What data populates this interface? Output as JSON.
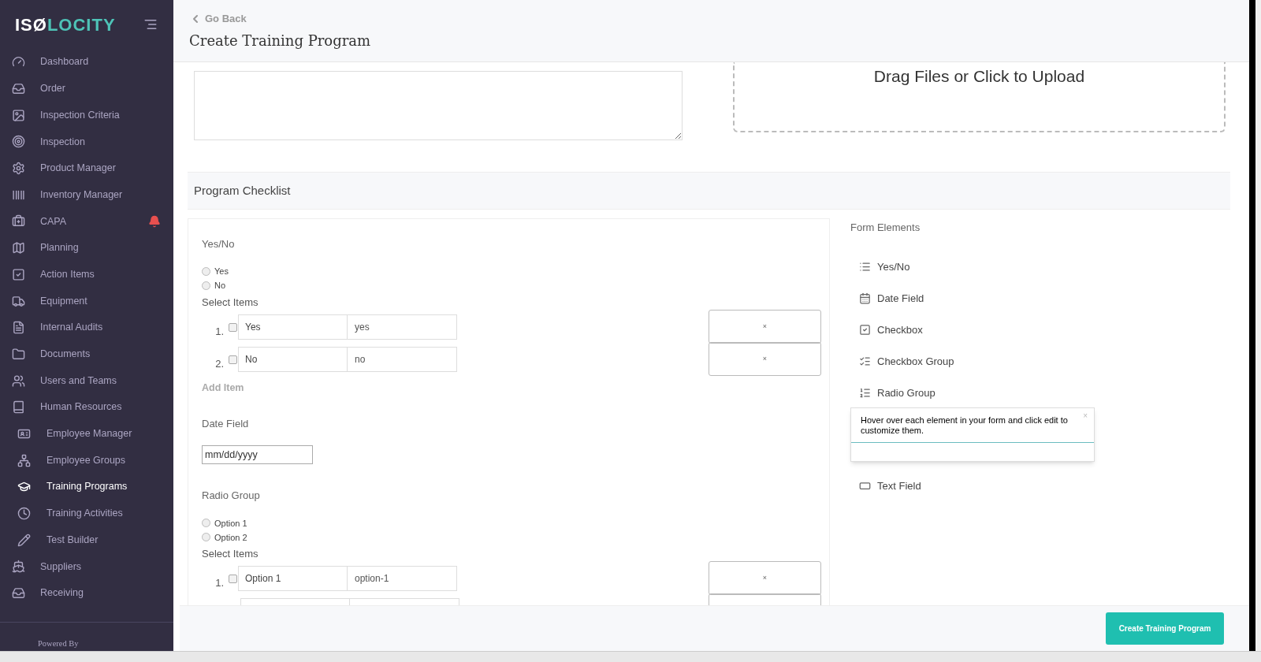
{
  "logo": {
    "lead": "ISØ",
    "rest": "LOCITY"
  },
  "sidebar": {
    "items": [
      {
        "label": "Dashboard",
        "selected": false,
        "alert": false
      },
      {
        "label": "Order",
        "selected": false,
        "alert": false
      },
      {
        "label": "Inspection Criteria",
        "selected": false,
        "alert": false
      },
      {
        "label": "Inspection",
        "selected": false,
        "alert": false
      },
      {
        "label": "Product Manager",
        "selected": false,
        "alert": false
      },
      {
        "label": "Inventory Manager",
        "selected": false,
        "alert": false
      },
      {
        "label": "CAPA",
        "selected": false,
        "alert": true
      },
      {
        "label": "Planning",
        "selected": false,
        "alert": false
      },
      {
        "label": "Action Items",
        "selected": false,
        "alert": false
      },
      {
        "label": "Equipment",
        "selected": false,
        "alert": false
      },
      {
        "label": "Internal Audits",
        "selected": false,
        "alert": false
      },
      {
        "label": "Documents",
        "selected": false,
        "alert": false
      },
      {
        "label": "Users and Teams",
        "selected": false,
        "alert": false
      },
      {
        "label": "Human Resources",
        "selected": false,
        "alert": false,
        "children": [
          {
            "label": "Employee Manager",
            "selected": false
          },
          {
            "label": "Employee Groups",
            "selected": false
          },
          {
            "label": "Training Programs",
            "selected": true
          },
          {
            "label": "Training Activities",
            "selected": false
          },
          {
            "label": "Test Builder",
            "selected": false
          }
        ]
      },
      {
        "label": "Suppliers",
        "selected": false,
        "alert": false
      },
      {
        "label": "Receiving",
        "selected": false,
        "alert": false
      }
    ],
    "footer": "Powered By"
  },
  "header": {
    "back": "Go Back",
    "title": "Create Training Program"
  },
  "upload": {
    "text": "Drag Files or Click to Upload"
  },
  "checklist": {
    "title": "Program Checklist",
    "sections": [
      {
        "kind": "choice",
        "title": "Yes/No",
        "options": [
          {
            "label": "Yes",
            "selected": false
          },
          {
            "label": "No",
            "selected": false
          }
        ],
        "select_label": "Select Items",
        "remove": "×",
        "items": [
          {
            "number": "1.",
            "checked": false,
            "label": "Yes",
            "value": "yes"
          },
          {
            "number": "2.",
            "checked": false,
            "label": "No",
            "value": "no"
          }
        ],
        "add_item": "Add Item"
      },
      {
        "kind": "date",
        "title": "Date Field",
        "placeholder": "mm/dd/yyyy"
      },
      {
        "kind": "choice",
        "title": "Radio Group",
        "options": [
          {
            "label": "Option 1",
            "selected": false
          },
          {
            "label": "Option 2",
            "selected": false
          }
        ],
        "select_label": "Select Items",
        "remove": "×",
        "items": [
          {
            "kind": "filled",
            "number": "1.",
            "checked": false,
            "label": "Option 1",
            "value": "option-1"
          },
          {
            "kind": "blank"
          }
        ]
      }
    ]
  },
  "form_elements": {
    "title": "Form Elements",
    "items": [
      {
        "label": "Yes/No"
      },
      {
        "label": "Date Field"
      },
      {
        "label": "Checkbox"
      },
      {
        "label": "Checkbox Group"
      },
      {
        "label": "Radio Group"
      },
      {
        "label": "Text Field"
      }
    ]
  },
  "tooltip": {
    "text": "Hover over each element in your form and click edit to customize them.",
    "close": "×"
  },
  "submit": "Create Training Program"
}
